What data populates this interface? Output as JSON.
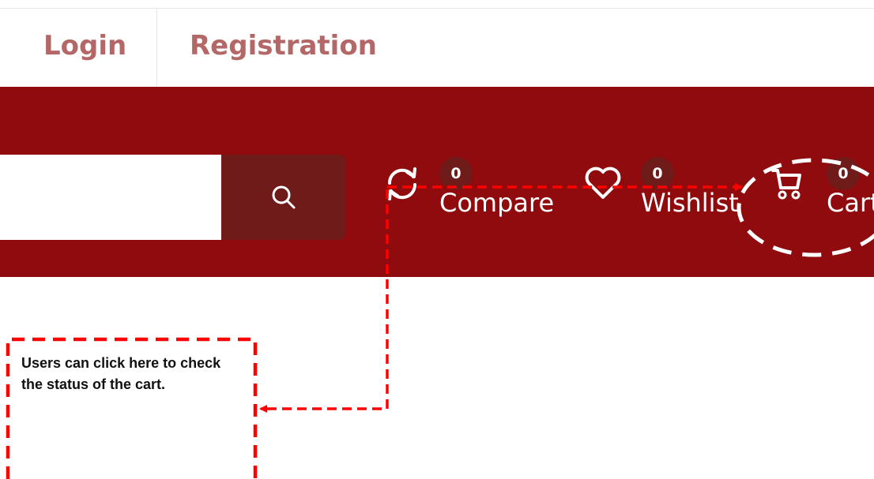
{
  "auth": {
    "login_label": "Login",
    "registration_label": "Registration"
  },
  "header": {
    "background_color": "#900b0d",
    "search": {
      "value": "",
      "button_icon": "search-icon"
    },
    "actions": [
      {
        "id": "compare",
        "label": "Compare",
        "count": "0",
        "icon": "refresh-icon"
      },
      {
        "id": "wishlist",
        "label": "Wishlist",
        "count": "0",
        "icon": "heart-icon"
      },
      {
        "id": "cart",
        "label": "Cart",
        "count": "0",
        "icon": "cart-icon"
      }
    ]
  },
  "annotation": {
    "text": "Users can click here to check the status of the cart.",
    "highlight_color": "#ff0000",
    "circle_color": "#ffffff"
  }
}
